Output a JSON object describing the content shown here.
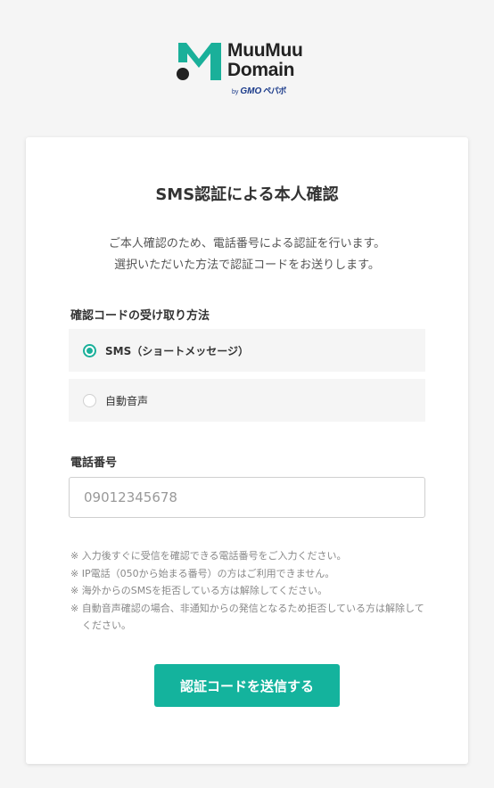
{
  "logo": {
    "line1": "MuuMuu",
    "line2": "Domain",
    "by": "by",
    "gmo": "GMO",
    "pepabo": "ペパボ",
    "brand_color": "#1ab09a"
  },
  "card": {
    "title": "SMS認証による本人確認",
    "description_line1": "ご本人確認のため、電話番号による認証を行います。",
    "description_line2": "選択いただいた方法で認証コードをお送りします。",
    "method_label": "確認コードの受け取り方法",
    "methods": [
      {
        "label": "SMS（ショートメッセージ）",
        "selected": true
      },
      {
        "label": "自動音声",
        "selected": false
      }
    ],
    "phone_label": "電話番号",
    "phone_placeholder": "09012345678",
    "notes": [
      "※ 入力後すぐに受信を確認できる電話番号をご入力ください。",
      "※ IP電話（050から始まる番号）の方はご利用できません。",
      "※ 海外からのSMSを拒否している方は解除してください。",
      "※ 自動音声確認の場合、非通知からの発信となるため拒否している方は解除してください。"
    ],
    "submit_label": "認証コードを送信する"
  },
  "colors": {
    "accent": "#14b39d",
    "background": "#f5f5f5"
  }
}
